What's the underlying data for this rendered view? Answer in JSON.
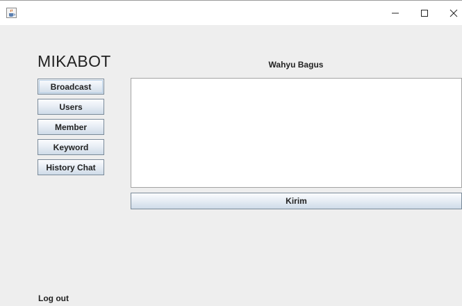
{
  "window": {
    "icon": "java-coffee-cup-icon",
    "controls": [
      "minimize-icon",
      "maximize-icon",
      "close-icon"
    ]
  },
  "header": {
    "app_title": "MIKABOT",
    "user_name": "Wahyu Bagus"
  },
  "sidebar": {
    "items": [
      {
        "label": "Broadcast"
      },
      {
        "label": "Users"
      },
      {
        "label": "Member"
      },
      {
        "label": "Keyword"
      },
      {
        "label": "History Chat"
      }
    ],
    "selected": "Broadcast"
  },
  "compose": {
    "message_value": "",
    "send_label": "Kirim"
  },
  "footer": {
    "logout_label": "Log out"
  },
  "colors": {
    "background": "#eeeeee",
    "titlebar": "#ffffff",
    "text": "#222222",
    "button_border": "#7a8a99"
  }
}
